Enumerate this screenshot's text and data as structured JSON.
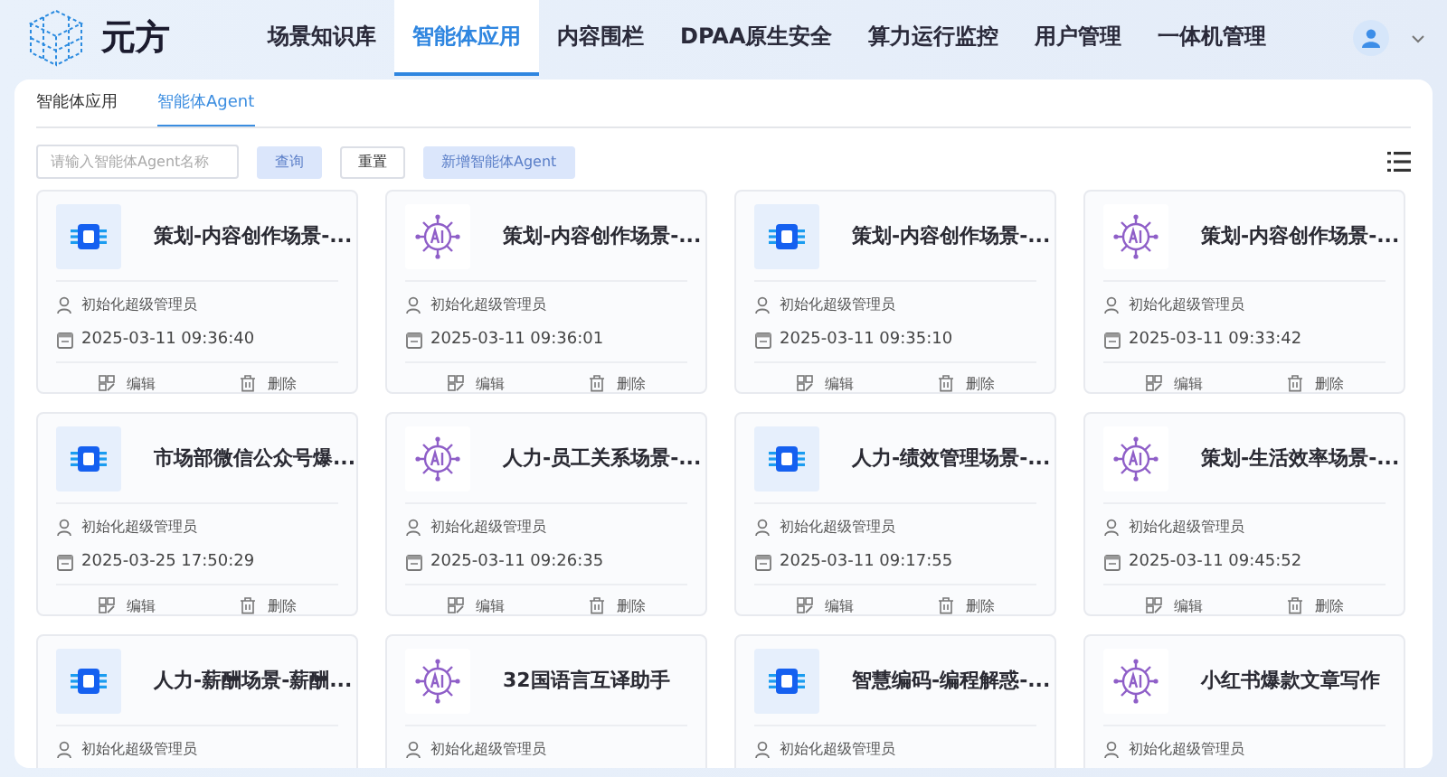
{
  "brand": {
    "name": "元方"
  },
  "nav": [
    {
      "label": "场景知识库",
      "selected": false
    },
    {
      "label": "智能体应用",
      "selected": true
    },
    {
      "label": "内容围栏",
      "selected": false
    },
    {
      "label": "DPAA原生安全",
      "selected": false
    },
    {
      "label": "算力运行监控",
      "selected": false
    },
    {
      "label": "用户管理",
      "selected": false
    },
    {
      "label": "一体机管理",
      "selected": false
    }
  ],
  "subtabs": [
    {
      "label": "智能体应用",
      "selected": false
    },
    {
      "label": "智能体Agent",
      "selected": true
    }
  ],
  "search": {
    "placeholder": "请输入智能体Agent名称"
  },
  "buttons": [
    {
      "label": "查询",
      "kind": "primary"
    },
    {
      "label": "重置",
      "kind": "plain"
    },
    {
      "label": "新增智能体Agent",
      "kind": "primary"
    }
  ],
  "cards": [
    {
      "kind": "chip",
      "title": "策划-内容创作场景-...",
      "creator": "初始化超级管理员",
      "time": "2025-03-11 09:36:40",
      "actions": [
        "编辑",
        "删除"
      ]
    },
    {
      "kind": "ai",
      "title": "策划-内容创作场景-...",
      "creator": "初始化超级管理员",
      "time": "2025-03-11 09:36:01",
      "actions": [
        "编辑",
        "删除"
      ]
    },
    {
      "kind": "chip",
      "title": "策划-内容创作场景-...",
      "creator": "初始化超级管理员",
      "time": "2025-03-11 09:35:10",
      "actions": [
        "编辑",
        "删除"
      ]
    },
    {
      "kind": "ai",
      "title": "策划-内容创作场景-...",
      "creator": "初始化超级管理员",
      "time": "2025-03-11 09:33:42",
      "actions": [
        "编辑",
        "删除"
      ]
    },
    {
      "kind": "chip",
      "title": "市场部微信公众号爆...",
      "creator": "初始化超级管理员",
      "time": "2025-03-25 17:50:29",
      "actions": [
        "编辑",
        "删除"
      ]
    },
    {
      "kind": "ai",
      "title": "人力-员工关系场景-...",
      "creator": "初始化超级管理员",
      "time": "2025-03-11 09:26:35",
      "actions": [
        "编辑",
        "删除"
      ]
    },
    {
      "kind": "chip",
      "title": "人力-绩效管理场景-...",
      "creator": "初始化超级管理员",
      "time": "2025-03-11 09:17:55",
      "actions": [
        "编辑",
        "删除"
      ]
    },
    {
      "kind": "ai",
      "title": "策划-生活效率场景-...",
      "creator": "初始化超级管理员",
      "time": "2025-03-11 09:45:52",
      "actions": [
        "编辑",
        "删除"
      ]
    },
    {
      "kind": "chip",
      "title": "人力-薪酬场景-薪酬...",
      "creator": "初始化超级管理员"
    },
    {
      "kind": "ai",
      "title": "32国语言互译助手",
      "creator": "初始化超级管理员"
    },
    {
      "kind": "chip",
      "title": "智慧编码-编程解惑-...",
      "creator": "初始化超级管理员"
    },
    {
      "kind": "ai",
      "title": "小红书爆款文章写作",
      "creator": "初始化超级管理员"
    }
  ]
}
